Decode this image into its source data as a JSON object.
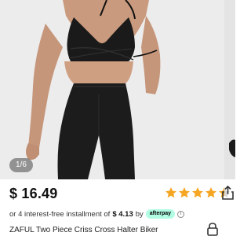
{
  "gallery": {
    "counter": "1/6",
    "image_alt": "Black two piece criss cross halter top and biker shorts set"
  },
  "product": {
    "price": "$ 16.49",
    "rating": 4.5,
    "rating_max": 5,
    "star_color": "#f5a623",
    "installment_prefix": "or 4 interest-free installment of",
    "installment_amount": "$ 4.13",
    "installment_by": "by",
    "afterpay_label": "afterpay",
    "info_glyph": "i",
    "title": "ZAFUL Two Piece Criss Cross Halter Biker"
  },
  "icons": {
    "share": "share-icon",
    "lock": "lock-icon",
    "info": "info-icon"
  }
}
